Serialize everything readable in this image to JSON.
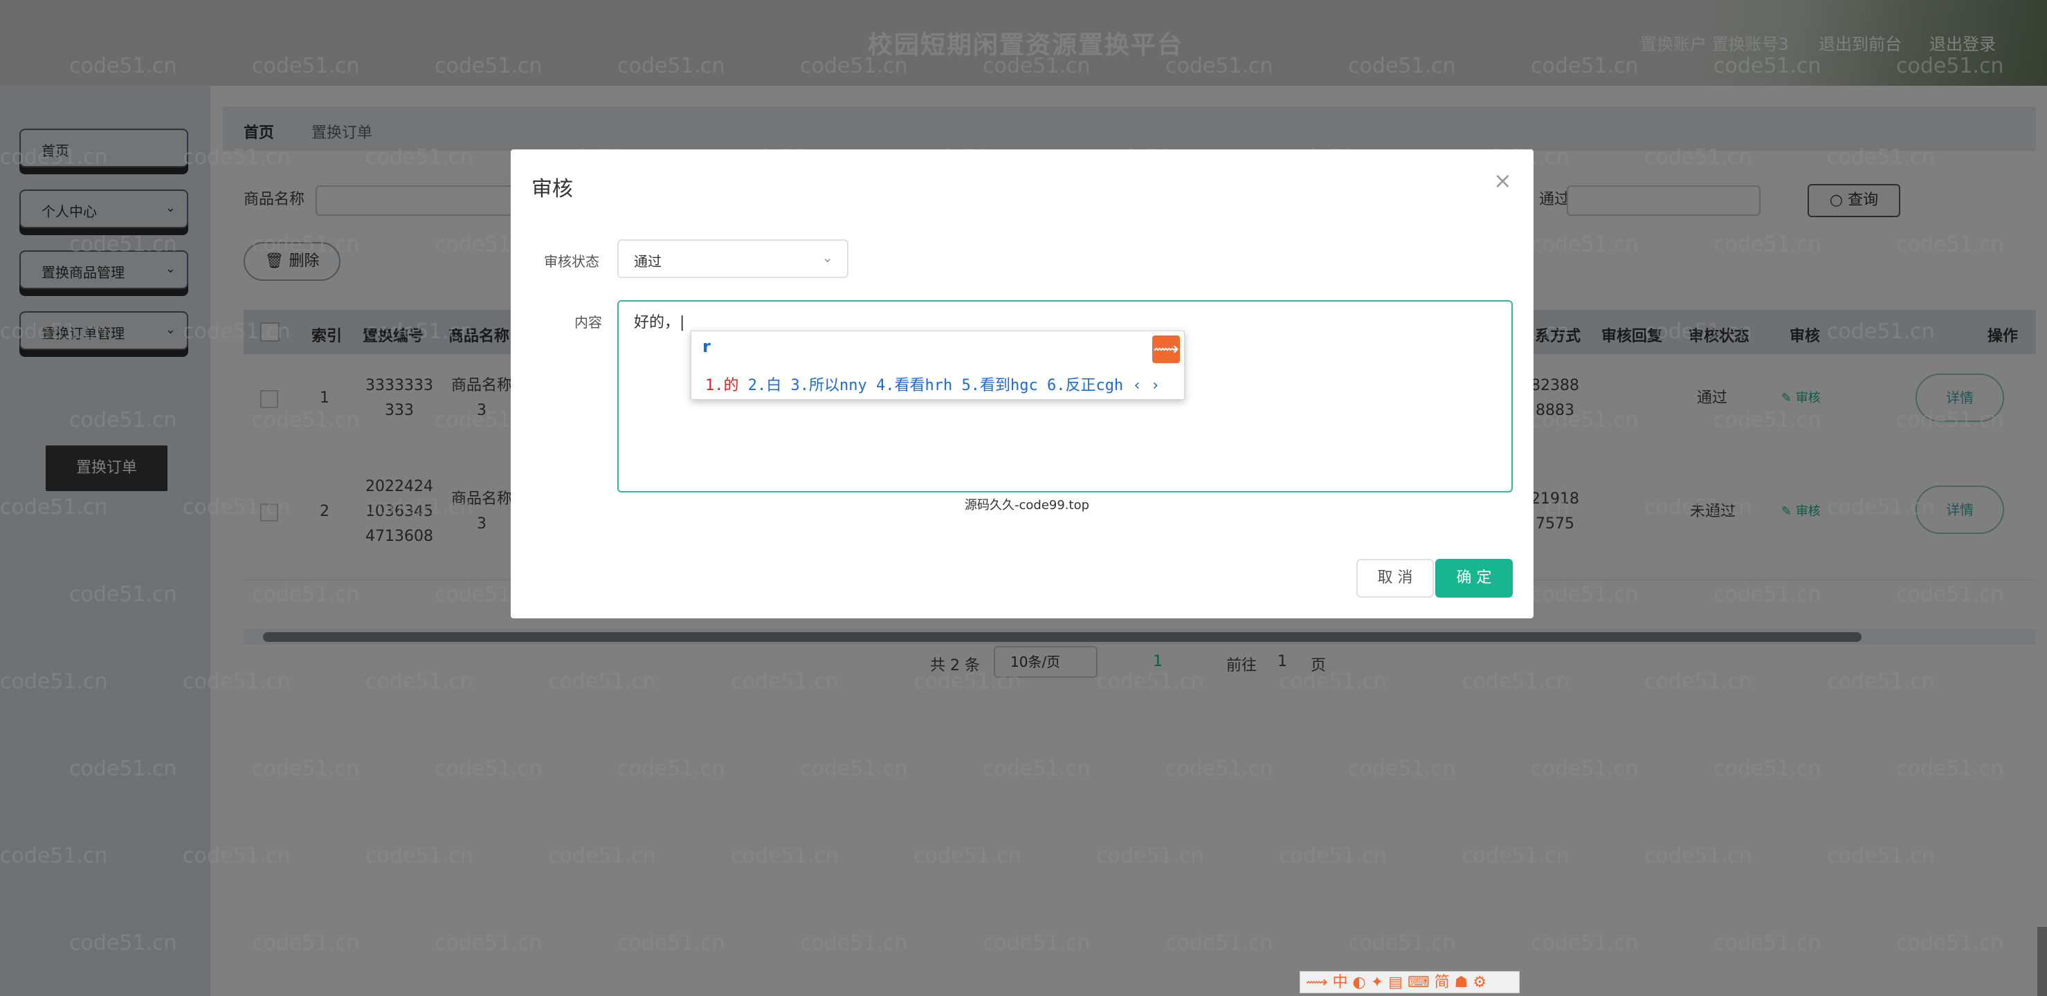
{
  "header": {
    "title": "校园短期闲置资源置换平台",
    "account_label": "置换账户 置换账号3",
    "nav_front": "退出到前台",
    "nav_logout": "退出登录"
  },
  "sidebar": {
    "items": [
      {
        "label": "首页"
      },
      {
        "label": "个人中心"
      },
      {
        "label": "置换商品管理"
      },
      {
        "label": "置换订单管理"
      }
    ],
    "active_sub": "置换订单"
  },
  "breadcrumb": {
    "home": "首页",
    "current": "置换订单"
  },
  "search": {
    "product_label": "商品名称",
    "audit_label_partial": "通过",
    "query_button": "查询"
  },
  "toolbar": {
    "delete_button": "删除"
  },
  "table": {
    "headers": [
      "索引",
      "置换编号",
      "商品名称",
      "系方式",
      "审核回复",
      "审核状态",
      "审核",
      "操作"
    ],
    "rows": [
      {
        "index": "1",
        "order_no": "3333333\n333",
        "product": "商品名称\n3",
        "contact": "82388\n8883",
        "status": "通过",
        "audit": "审核",
        "detail": "详情"
      },
      {
        "index": "2",
        "order_no": "2022424\n1036345\n4713608",
        "product": "商品名称\n3",
        "contact": "21918\n7575",
        "status": "未通过",
        "audit": "审核",
        "detail": "详情"
      }
    ]
  },
  "pagination": {
    "total": "共 2 条",
    "page_size": "10条/页",
    "current_page": "1",
    "goto_label": "前往",
    "goto_value": "1",
    "page_suffix": "页"
  },
  "dialog": {
    "title": "审核",
    "status_label": "审核状态",
    "status_value": "通过",
    "content_label": "内容",
    "content_value": "好的，|",
    "caption": "源码久久-code99.top",
    "cancel_button": "取 消",
    "ok_button": "确 定"
  },
  "ime": {
    "composition": "r",
    "candidates": [
      "1.的",
      "2.白",
      "3.所以nny",
      "4.看看hrh",
      "5.看到hgc",
      "6.反正cgh"
    ]
  },
  "watermark": "code51.cn",
  "colors": {
    "accent": "#17b690",
    "overlay": "rgba(0,0,0,0.5)",
    "ime_text": "#1b6bd6"
  }
}
